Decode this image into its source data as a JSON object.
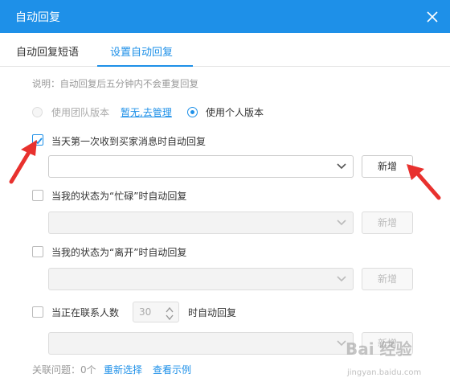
{
  "window": {
    "title": "自动回复"
  },
  "tabs": [
    {
      "label": "自动回复短语"
    },
    {
      "label": "设置自动回复"
    }
  ],
  "note": "说明：自动回复后五分钟内不会重复回复",
  "version": {
    "team_label": "使用团队版本",
    "manage_link": "暂无,去管理",
    "personal_label": "使用个人版本",
    "selected": "personal"
  },
  "rules": [
    {
      "label": "当天第一次收到买家消息时自动回复",
      "checked": true,
      "add_label": "新增"
    },
    {
      "label": "当我的状态为“忙碌”时自动回复",
      "checked": false,
      "add_label": "新增"
    },
    {
      "label": "当我的状态为“离开”时自动回复",
      "checked": false,
      "add_label": "新增"
    },
    {
      "label_prefix": "当正在联系人数",
      "count": "30",
      "label_suffix": "时自动回复",
      "checked": false,
      "add_label": "新增"
    }
  ],
  "footer": {
    "related": "关联问题：0个",
    "reselect": "重新选择",
    "example": "查看示例"
  },
  "watermark": {
    "text": "Bai 经验",
    "sub": "jingyan.baidu.com"
  },
  "colors": {
    "accent": "#1e90e8",
    "annotation": "#e8312e"
  }
}
